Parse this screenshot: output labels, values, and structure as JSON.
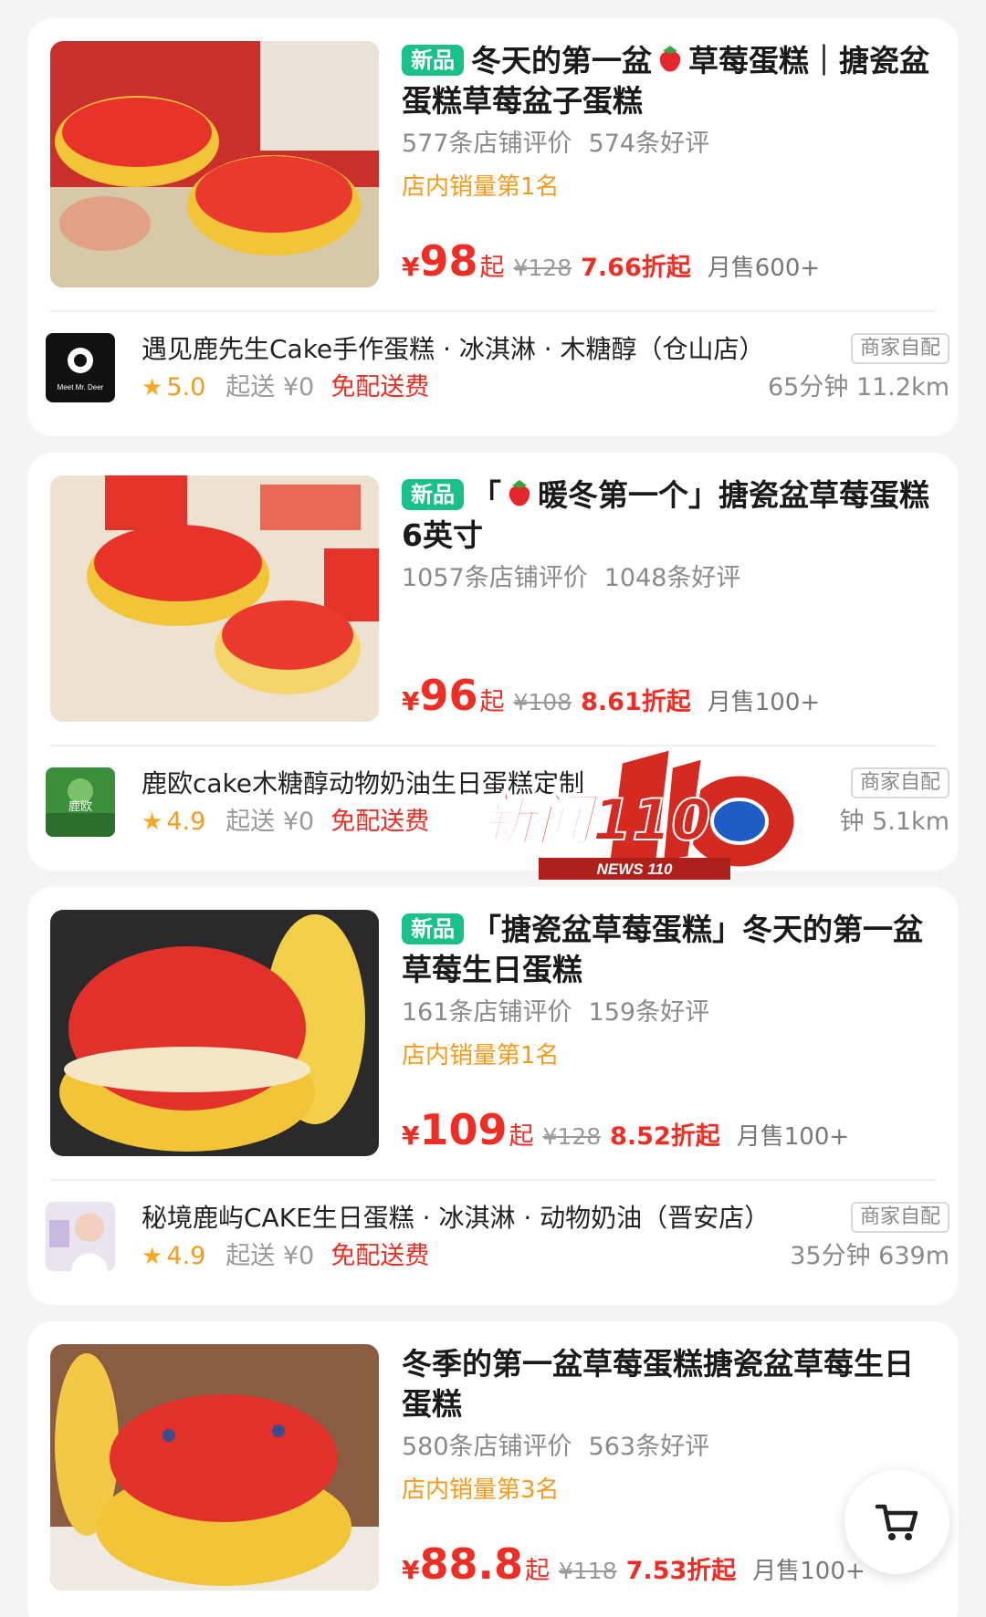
{
  "cards": [
    {
      "badge": "新品",
      "title_part1": "冬天的第一盆",
      "title_part2": "草莓蛋糕｜搪瓷盆蛋糕草莓盆子蛋糕",
      "reviews": "577条店铺评价",
      "good_reviews": "574条好评",
      "rank": "店内销量第1名",
      "currency": "¥",
      "price": "98",
      "price_suffix": "起",
      "orig_price": "¥128",
      "discount": "7.66折起",
      "monthly_sales": "月售600+",
      "shop_name": "遇见鹿先生Cake手作蛋糕 · 冰淇淋 · 木糖醇（仓山店）",
      "rating": "5.0",
      "min_order": "起送 ¥0",
      "free_delivery": "免配送费",
      "delivery_tag": "商家自配",
      "eta_distance": "65分钟  11.2km",
      "logo_text": "Meet Mr. Deer"
    },
    {
      "badge": "新品",
      "title_part1": "「",
      "title_part2": "暖冬第一个」搪瓷盆草莓蛋糕6英寸",
      "reviews": "1057条店铺评价",
      "good_reviews": "1048条好评",
      "rank": "",
      "currency": "¥",
      "price": "96",
      "price_suffix": "起",
      "orig_price": "¥108",
      "discount": "8.61折起",
      "monthly_sales": "月售100+",
      "shop_name": "鹿欧cake木糖醇动物奶油生日蛋糕定制",
      "rating": "4.9",
      "min_order": "起送 ¥0",
      "free_delivery": "免配送费",
      "delivery_tag": "商家自配",
      "eta_distance": "钟  5.1km",
      "logo_text": "鹿欧"
    },
    {
      "badge": "新品",
      "title_part1": "",
      "title_part2": "「搪瓷盆草莓蛋糕」冬天的第一盆草莓生日蛋糕",
      "reviews": "161条店铺评价",
      "good_reviews": "159条好评",
      "rank": "店内销量第1名",
      "currency": "¥",
      "price": "109",
      "price_suffix": "起",
      "orig_price": "¥128",
      "discount": "8.52折起",
      "monthly_sales": "月售100+",
      "shop_name": "秘境鹿屿CAKE生日蛋糕 · 冰淇淋 · 动物奶油（晋安店）",
      "rating": "4.9",
      "min_order": "起送 ¥0",
      "free_delivery": "免配送费",
      "delivery_tag": "商家自配",
      "eta_distance": "35分钟  639m",
      "logo_text": ""
    },
    {
      "badge": "",
      "title_part1": "",
      "title_part2": "冬季的第一盆草莓蛋糕搪瓷盆草莓生日蛋糕",
      "reviews": "580条店铺评价",
      "good_reviews": "563条好评",
      "rank": "店内销量第3名",
      "currency": "¥",
      "price": "88.8",
      "price_suffix": "起",
      "orig_price": "¥118",
      "discount": "7.53折起",
      "monthly_sales": "月售100+"
    }
  ],
  "watermark": {
    "main": "新闻110",
    "sub": "NEWS 110"
  },
  "icons": {
    "cart": "cart-icon",
    "star": "star-icon",
    "strawberry": "strawberry-icon"
  },
  "colors": {
    "price_red": "#ee2e24",
    "badge_green": "#19c08a",
    "rank_orange": "#f59a1a",
    "star": "#f7a823"
  }
}
